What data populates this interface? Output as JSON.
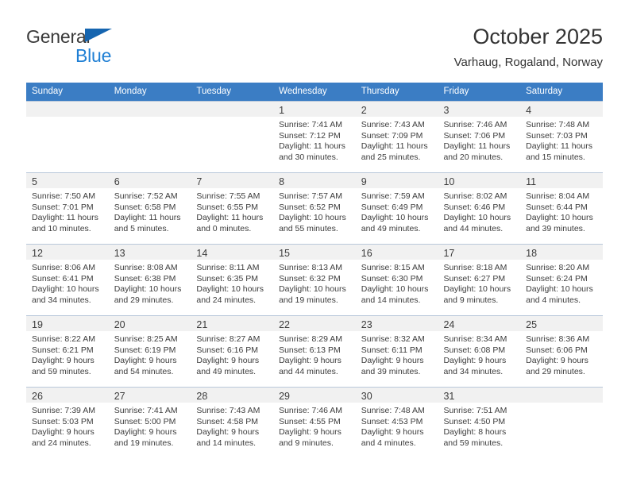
{
  "brand": {
    "line1": "General",
    "line2": "Blue",
    "triangle_color": "#1565b0",
    "line2_color": "#1f7fd4"
  },
  "header": {
    "title": "October 2025",
    "subtitle": "Varhaug, Rogaland, Norway"
  },
  "theme": {
    "header_bg": "#3b7dc4",
    "header_text": "#ffffff",
    "daynum_strip_bg": "#f1f1f1",
    "grid_line": "#b9c8da",
    "body_text": "#3c3c3c"
  },
  "weekdays": [
    "Sunday",
    "Monday",
    "Tuesday",
    "Wednesday",
    "Thursday",
    "Friday",
    "Saturday"
  ],
  "labels": {
    "sunrise": "Sunrise:",
    "sunset": "Sunset:",
    "daylight": "Daylight:"
  },
  "weeks": [
    [
      {
        "day": "",
        "sunrise": "",
        "sunset": "",
        "daylight_1": "",
        "daylight_2": ""
      },
      {
        "day": "",
        "sunrise": "",
        "sunset": "",
        "daylight_1": "",
        "daylight_2": ""
      },
      {
        "day": "",
        "sunrise": "",
        "sunset": "",
        "daylight_1": "",
        "daylight_2": ""
      },
      {
        "day": "1",
        "sunrise": "Sunrise: 7:41 AM",
        "sunset": "Sunset: 7:12 PM",
        "daylight_1": "Daylight: 11 hours",
        "daylight_2": "and 30 minutes."
      },
      {
        "day": "2",
        "sunrise": "Sunrise: 7:43 AM",
        "sunset": "Sunset: 7:09 PM",
        "daylight_1": "Daylight: 11 hours",
        "daylight_2": "and 25 minutes."
      },
      {
        "day": "3",
        "sunrise": "Sunrise: 7:46 AM",
        "sunset": "Sunset: 7:06 PM",
        "daylight_1": "Daylight: 11 hours",
        "daylight_2": "and 20 minutes."
      },
      {
        "day": "4",
        "sunrise": "Sunrise: 7:48 AM",
        "sunset": "Sunset: 7:03 PM",
        "daylight_1": "Daylight: 11 hours",
        "daylight_2": "and 15 minutes."
      }
    ],
    [
      {
        "day": "5",
        "sunrise": "Sunrise: 7:50 AM",
        "sunset": "Sunset: 7:01 PM",
        "daylight_1": "Daylight: 11 hours",
        "daylight_2": "and 10 minutes."
      },
      {
        "day": "6",
        "sunrise": "Sunrise: 7:52 AM",
        "sunset": "Sunset: 6:58 PM",
        "daylight_1": "Daylight: 11 hours",
        "daylight_2": "and 5 minutes."
      },
      {
        "day": "7",
        "sunrise": "Sunrise: 7:55 AM",
        "sunset": "Sunset: 6:55 PM",
        "daylight_1": "Daylight: 11 hours",
        "daylight_2": "and 0 minutes."
      },
      {
        "day": "8",
        "sunrise": "Sunrise: 7:57 AM",
        "sunset": "Sunset: 6:52 PM",
        "daylight_1": "Daylight: 10 hours",
        "daylight_2": "and 55 minutes."
      },
      {
        "day": "9",
        "sunrise": "Sunrise: 7:59 AM",
        "sunset": "Sunset: 6:49 PM",
        "daylight_1": "Daylight: 10 hours",
        "daylight_2": "and 49 minutes."
      },
      {
        "day": "10",
        "sunrise": "Sunrise: 8:02 AM",
        "sunset": "Sunset: 6:46 PM",
        "daylight_1": "Daylight: 10 hours",
        "daylight_2": "and 44 minutes."
      },
      {
        "day": "11",
        "sunrise": "Sunrise: 8:04 AM",
        "sunset": "Sunset: 6:44 PM",
        "daylight_1": "Daylight: 10 hours",
        "daylight_2": "and 39 minutes."
      }
    ],
    [
      {
        "day": "12",
        "sunrise": "Sunrise: 8:06 AM",
        "sunset": "Sunset: 6:41 PM",
        "daylight_1": "Daylight: 10 hours",
        "daylight_2": "and 34 minutes."
      },
      {
        "day": "13",
        "sunrise": "Sunrise: 8:08 AM",
        "sunset": "Sunset: 6:38 PM",
        "daylight_1": "Daylight: 10 hours",
        "daylight_2": "and 29 minutes."
      },
      {
        "day": "14",
        "sunrise": "Sunrise: 8:11 AM",
        "sunset": "Sunset: 6:35 PM",
        "daylight_1": "Daylight: 10 hours",
        "daylight_2": "and 24 minutes."
      },
      {
        "day": "15",
        "sunrise": "Sunrise: 8:13 AM",
        "sunset": "Sunset: 6:32 PM",
        "daylight_1": "Daylight: 10 hours",
        "daylight_2": "and 19 minutes."
      },
      {
        "day": "16",
        "sunrise": "Sunrise: 8:15 AM",
        "sunset": "Sunset: 6:30 PM",
        "daylight_1": "Daylight: 10 hours",
        "daylight_2": "and 14 minutes."
      },
      {
        "day": "17",
        "sunrise": "Sunrise: 8:18 AM",
        "sunset": "Sunset: 6:27 PM",
        "daylight_1": "Daylight: 10 hours",
        "daylight_2": "and 9 minutes."
      },
      {
        "day": "18",
        "sunrise": "Sunrise: 8:20 AM",
        "sunset": "Sunset: 6:24 PM",
        "daylight_1": "Daylight: 10 hours",
        "daylight_2": "and 4 minutes."
      }
    ],
    [
      {
        "day": "19",
        "sunrise": "Sunrise: 8:22 AM",
        "sunset": "Sunset: 6:21 PM",
        "daylight_1": "Daylight: 9 hours",
        "daylight_2": "and 59 minutes."
      },
      {
        "day": "20",
        "sunrise": "Sunrise: 8:25 AM",
        "sunset": "Sunset: 6:19 PM",
        "daylight_1": "Daylight: 9 hours",
        "daylight_2": "and 54 minutes."
      },
      {
        "day": "21",
        "sunrise": "Sunrise: 8:27 AM",
        "sunset": "Sunset: 6:16 PM",
        "daylight_1": "Daylight: 9 hours",
        "daylight_2": "and 49 minutes."
      },
      {
        "day": "22",
        "sunrise": "Sunrise: 8:29 AM",
        "sunset": "Sunset: 6:13 PM",
        "daylight_1": "Daylight: 9 hours",
        "daylight_2": "and 44 minutes."
      },
      {
        "day": "23",
        "sunrise": "Sunrise: 8:32 AM",
        "sunset": "Sunset: 6:11 PM",
        "daylight_1": "Daylight: 9 hours",
        "daylight_2": "and 39 minutes."
      },
      {
        "day": "24",
        "sunrise": "Sunrise: 8:34 AM",
        "sunset": "Sunset: 6:08 PM",
        "daylight_1": "Daylight: 9 hours",
        "daylight_2": "and 34 minutes."
      },
      {
        "day": "25",
        "sunrise": "Sunrise: 8:36 AM",
        "sunset": "Sunset: 6:06 PM",
        "daylight_1": "Daylight: 9 hours",
        "daylight_2": "and 29 minutes."
      }
    ],
    [
      {
        "day": "26",
        "sunrise": "Sunrise: 7:39 AM",
        "sunset": "Sunset: 5:03 PM",
        "daylight_1": "Daylight: 9 hours",
        "daylight_2": "and 24 minutes."
      },
      {
        "day": "27",
        "sunrise": "Sunrise: 7:41 AM",
        "sunset": "Sunset: 5:00 PM",
        "daylight_1": "Daylight: 9 hours",
        "daylight_2": "and 19 minutes."
      },
      {
        "day": "28",
        "sunrise": "Sunrise: 7:43 AM",
        "sunset": "Sunset: 4:58 PM",
        "daylight_1": "Daylight: 9 hours",
        "daylight_2": "and 14 minutes."
      },
      {
        "day": "29",
        "sunrise": "Sunrise: 7:46 AM",
        "sunset": "Sunset: 4:55 PM",
        "daylight_1": "Daylight: 9 hours",
        "daylight_2": "and 9 minutes."
      },
      {
        "day": "30",
        "sunrise": "Sunrise: 7:48 AM",
        "sunset": "Sunset: 4:53 PM",
        "daylight_1": "Daylight: 9 hours",
        "daylight_2": "and 4 minutes."
      },
      {
        "day": "31",
        "sunrise": "Sunrise: 7:51 AM",
        "sunset": "Sunset: 4:50 PM",
        "daylight_1": "Daylight: 8 hours",
        "daylight_2": "and 59 minutes."
      },
      {
        "day": "",
        "sunrise": "",
        "sunset": "",
        "daylight_1": "",
        "daylight_2": ""
      }
    ]
  ]
}
